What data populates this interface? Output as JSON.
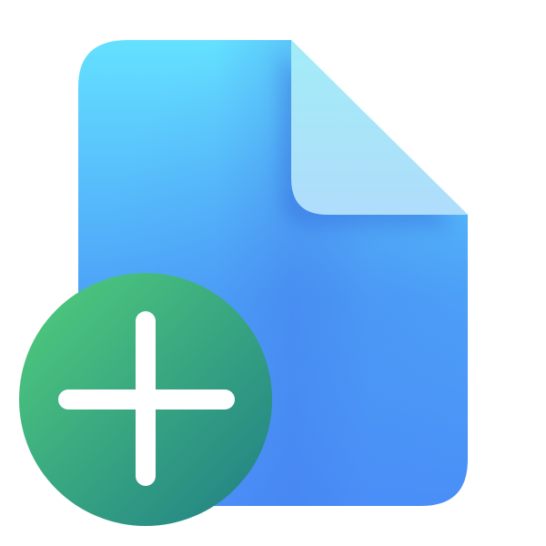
{
  "icon": {
    "name": "new-file-icon",
    "parts": [
      "document-icon",
      "plus-badge-icon"
    ],
    "colors": {
      "background": "#ffffff",
      "document_top": "#64E1FF",
      "document_bottom": "#4A8EF7",
      "document_shadow": "#3F6FE6",
      "fold_light": "#A2ECF7",
      "fold_dark": "#AFDDFB",
      "badge_top": "#52CF7B",
      "badge_bottom": "#1F7E86",
      "plus": "#ffffff"
    }
  }
}
